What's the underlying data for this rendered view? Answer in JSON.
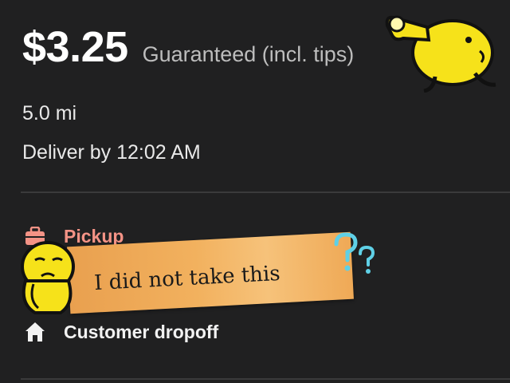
{
  "offer": {
    "pay_amount": "$3.25",
    "pay_note": "Guaranteed (incl. tips)",
    "distance": "5.0 mi",
    "deliver_by": "Deliver by 12:02 AM"
  },
  "stops": [
    {
      "label": "Pickup",
      "icon": "briefcase-icon",
      "color": "#f49386"
    },
    {
      "label": "Customer dropoff",
      "icon": "house-icon",
      "color": "#f2f2f2"
    }
  ],
  "annotation": {
    "note": "I did not take this",
    "tape_color": "#f2b15e",
    "sticker_color": "#f6e21a",
    "qmark_color": "#5fd0e6"
  },
  "colors": {
    "background": "#202021",
    "accent": "#f49386"
  }
}
